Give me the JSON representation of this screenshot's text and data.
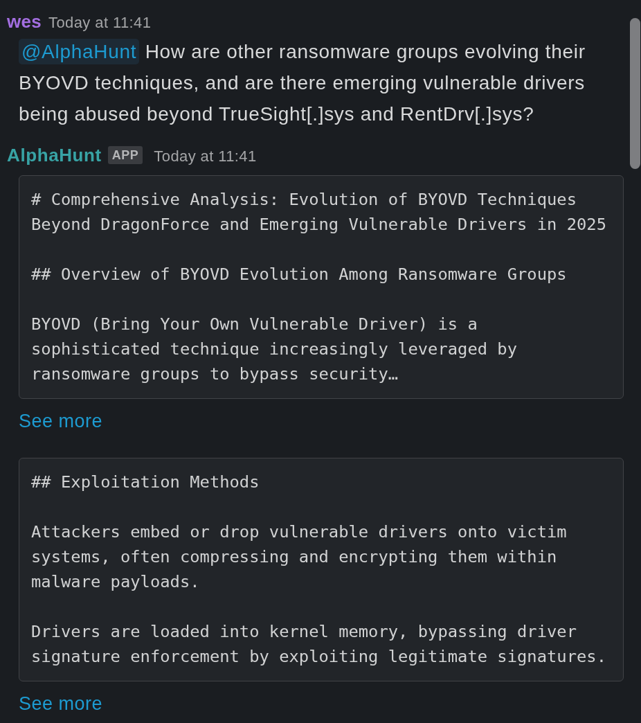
{
  "messages": [
    {
      "author": "wes",
      "color": "#a36ee0",
      "time": "Today at 11:41",
      "text": [
        {
          "kind": "mention",
          "text": "@AlphaHunt"
        },
        {
          "kind": "plain",
          "text": " How are other ransomware groups evolving their BYOVD techniques, and are there emerging vulnerable drivers being abused beyond TrueSight[.]sys and RentDrv[.]sys?"
        }
      ]
    },
    {
      "author": "AlphaHunt",
      "color": "#38a3a5",
      "badge": "APP",
      "time": "Today at 11:41",
      "blocks": [
        {
          "code": "# Comprehensive Analysis: Evolution of BYOVD Techniques Beyond DragonForce and Emerging Vulnerable Drivers in 2025\n\n## Overview of BYOVD Evolution Among Ransomware Groups\n\nBYOVD (Bring Your Own Vulnerable Driver) is a sophisticated technique increasingly leveraged by ransomware groups to bypass security…",
          "link": "See more"
        },
        {
          "code": "## Exploitation Methods\n\nAttackers embed or drop vulnerable drivers onto victim systems, often compressing and encrypting them within malware payloads.\n\nDrivers are loaded into kernel memory, bypassing driver signature enforcement by exploiting legitimate signatures.",
          "link": "See more"
        }
      ]
    }
  ]
}
